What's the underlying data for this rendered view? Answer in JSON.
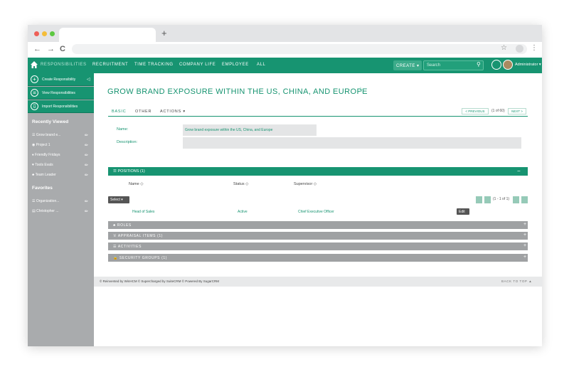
{
  "browser": {
    "new_tab_symbol": "+",
    "back": "←",
    "forward": "→",
    "reload": "C",
    "bookmark": "☆",
    "menu": "⋮"
  },
  "nav": {
    "home_icon": "home-icon",
    "items": [
      "RESPONSIBILITIES",
      "RECRUITMENT",
      "TIME TRACKING",
      "COMPANY LIFE",
      "EMPLOYEE",
      "ALL"
    ],
    "active_index": 0,
    "create_label": "CREATE ▾",
    "search_placeholder": "Search",
    "admin_label": "Administrator ▾",
    "accent_color": "#179471"
  },
  "sidebar": {
    "actions": [
      {
        "icon": "+",
        "label": "Create Responsibility"
      },
      {
        "icon": "≡",
        "label": "View Responsibilities"
      },
      {
        "icon": "⇩",
        "label": "Import Responsibilities"
      }
    ],
    "recently_viewed_title": "Recently Viewed",
    "recently_viewed": [
      {
        "icon": "☰",
        "label": "Grow brand e..."
      },
      {
        "icon": "◉",
        "label": "Project 1"
      },
      {
        "icon": "♦",
        "label": "Friendly Fridays"
      },
      {
        "icon": "♥",
        "label": "Tools Evals"
      },
      {
        "icon": "♣",
        "label": "Team Leader"
      }
    ],
    "favorites_title": "Favorites",
    "favorites": [
      {
        "icon": "☰",
        "label": "Organization..."
      },
      {
        "icon": "▤",
        "label": "Christopher ..."
      }
    ]
  },
  "page": {
    "title": "GROW BRAND EXPOSURE WITHIN THE US, CHINA, AND EUROPE",
    "favorite_star": "☆",
    "tabs": [
      "BASIC",
      "OTHER",
      "ACTIONS ▾"
    ],
    "active_tab_index": 0,
    "pager": {
      "previous": "< PREVIOUS",
      "count": "(1 of 60)",
      "next": "NEXT >"
    }
  },
  "detail": {
    "name_label": "Name:",
    "name_value": "Grow brand exposure within the US, China, and Europe",
    "description_label": "Description:",
    "description_value": ""
  },
  "positions": {
    "title": "☰ POSITIONS (1)",
    "collapse": "−",
    "columns": [
      "Name ◇",
      "Status ◇",
      "Supervisor ◇"
    ],
    "select_label": "Select ▾",
    "pagination_text": "(1 - 1 of 1)",
    "rows": [
      {
        "name": "Head of Sales",
        "status": "Active",
        "supervisor": "Chief Executive Officer",
        "edit": "Edit ▾"
      }
    ]
  },
  "subpanels": [
    {
      "icon": "♣",
      "title": "ROLES"
    },
    {
      "icon": "♉",
      "title": "APPRAISAL ITEMS (1)"
    },
    {
      "icon": "☰",
      "title": "ACTIVITIES"
    },
    {
      "icon": "🔒",
      "title": "SECURITY GROUPS (1)"
    }
  ],
  "subpanel_expand": "+",
  "footer": {
    "text": "© Reinvented by WinHCM  © Supercharged by SuiteCRM  © Powered By SugarCRM",
    "back_to_top": "BACK TO TOP ▲"
  }
}
